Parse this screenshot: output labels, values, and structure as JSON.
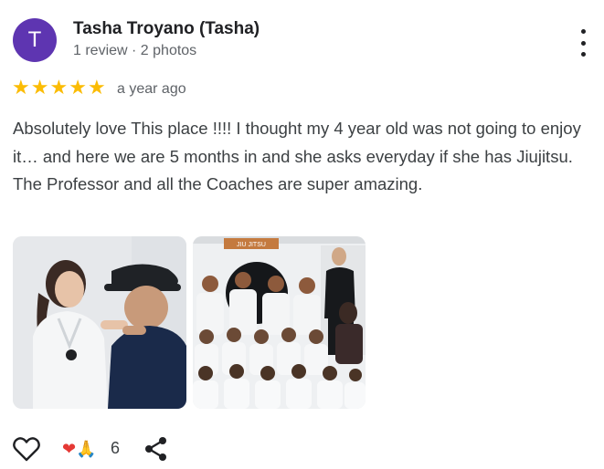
{
  "reviewer": {
    "initial": "T",
    "name": "Tasha Troyano (Tasha)",
    "meta": "1 review · 2 photos",
    "avatar_color": "#5e35b1"
  },
  "rating": {
    "stars": 5,
    "max": 5,
    "star_color": "#fbbc04",
    "time": "a year ago"
  },
  "review_text": "Absolutely love This place !!!! I thought my 4 year old was not going to enjoy it… and here we are 5 months in and she asks everyday if she has Jiujitsu. The Professor and all the Coaches are super amazing.",
  "photos": [
    {
      "description_icon": "photo-coach-and-child"
    },
    {
      "description_icon": "photo-jiujitsu-class-group"
    }
  ],
  "actions": {
    "reactions": "❤🙏",
    "reaction_count": "6"
  },
  "photo_signage": "JIU JITSU"
}
